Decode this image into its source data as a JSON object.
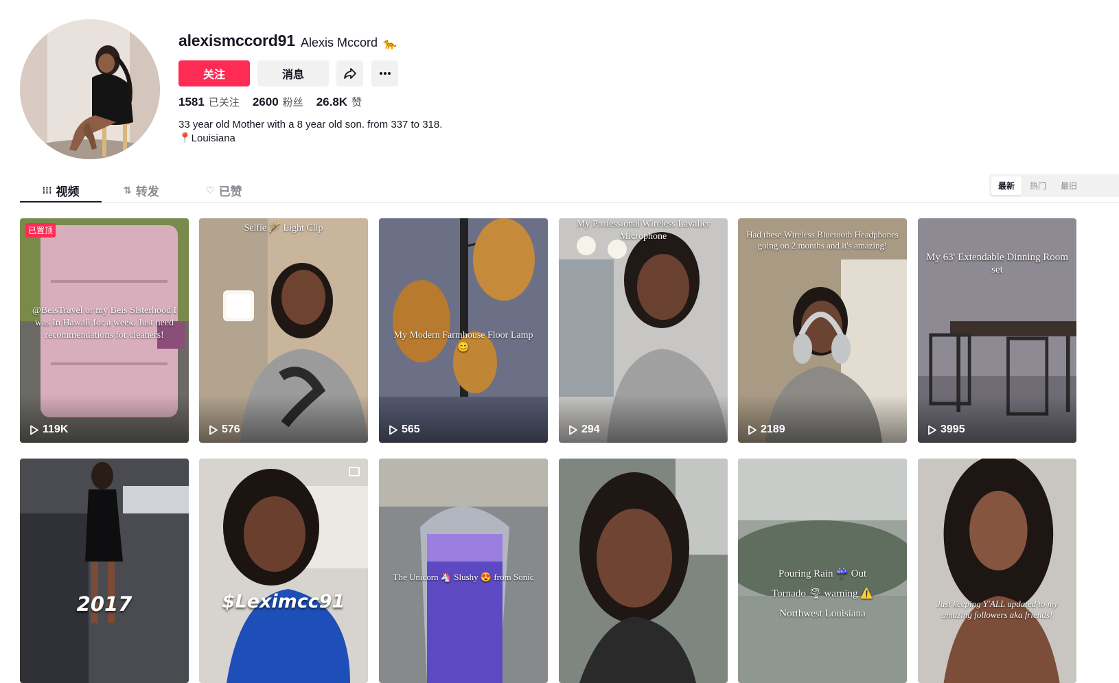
{
  "profile": {
    "username": "alexismccord91",
    "nickname": "Alexis Mccord",
    "nickname_emoji": "🐆",
    "follow_label": "关注",
    "message_label": "消息",
    "share_icon": "share-icon",
    "more_icon": "more-icon",
    "stats": [
      {
        "value": "1581",
        "label": "已关注"
      },
      {
        "value": "2600",
        "label": "粉丝"
      },
      {
        "value": "26.8K",
        "label": "赞"
      }
    ],
    "bio_line1": "33 year old Mother with a 8 year old son. from 337 to 318.",
    "bio_line2": "📍Louisiana"
  },
  "tabs": [
    {
      "label": "视频",
      "icon": "grid-icon"
    },
    {
      "label": "转发",
      "icon": "repost-icon"
    },
    {
      "label": "已赞",
      "icon": "liked-icon"
    }
  ],
  "sort": {
    "newest": "最新",
    "hot": "热门",
    "oldest": "最旧"
  },
  "videos_row1": [
    {
      "views": "119K",
      "pinned": "已置顶",
      "caption": "@BeisTravel or my Beis Sisterhood I was In Hawaii for a week. Just need recommendations for cleaners!"
    },
    {
      "views": "576",
      "caption": "Selfie 🪄 Light Clip"
    },
    {
      "views": "565",
      "caption": "My Modern Farmhouse Floor Lamp 😊"
    },
    {
      "views": "294",
      "caption": "My Professional Wireless Lavalier Microphone"
    },
    {
      "views": "2189",
      "caption": "Had these Wireless Bluetooth Headphones going on 2 months and it's amazing!"
    },
    {
      "views": "3995",
      "caption": "My 63' Extendable Dinning Room set"
    }
  ],
  "videos_row2": [
    {
      "overlay": "2017"
    },
    {
      "overlay": "$Leximcc91"
    },
    {
      "caption": "The Unicorn 🦄 Slushy 😍 from Sonic"
    },
    {
      "caption": ""
    },
    {
      "caption_l1": "Pouring Rain ☔ Out",
      "caption_l2": "Tornado 🌪 warning ⚠️",
      "caption_l3": "Northwest Louisiana"
    },
    {
      "caption": "Just keeping Y'ALL updated to my amazing followers aka friends!"
    }
  ],
  "colors": {
    "accent": "#fe2c55",
    "text": "#161823",
    "muted": "#8a8b91",
    "button_bg": "#f1f1f2"
  }
}
